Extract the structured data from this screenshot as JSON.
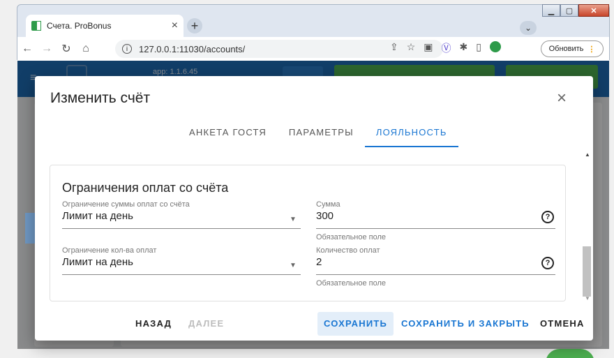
{
  "browser": {
    "tab_title": "Счета. ProBonus",
    "tab_close": "×",
    "new_tab": "+",
    "address": "127.0.0.1:11030/accounts/",
    "update_label": "Обновить",
    "update_dots": "⋮",
    "tab_menu": "⌄"
  },
  "app": {
    "version": "app: 1.1.6.45"
  },
  "dialog": {
    "title": "Изменить счёт",
    "close": "×",
    "tabs": [
      {
        "label": "Анкета гостя",
        "active": false
      },
      {
        "label": "Параметры",
        "active": false
      },
      {
        "label": "Лояльность",
        "active": true
      }
    ],
    "section_title": "Ограничения оплат со счёта",
    "fields": {
      "sum_limit": {
        "label": "Ограничение суммы оплат со счёта",
        "value": "Лимит на день"
      },
      "sum": {
        "label": "Сумма",
        "value": "300",
        "hint": "Обязательное поле"
      },
      "count_limit": {
        "label": "Ограничение кол-ва оплат",
        "value": "Лимит на день"
      },
      "count": {
        "label": "Количество оплат",
        "value": "2",
        "hint": "Обязательное поле"
      }
    },
    "buttons": {
      "back": "Назад",
      "next": "Далее",
      "save": "Сохранить",
      "save_close": "Сохранить и закрыть",
      "cancel": "Отмена"
    }
  },
  "colors": {
    "accent": "#1976d2",
    "appbar": "#1e6cb3",
    "green": "#4caf50"
  }
}
